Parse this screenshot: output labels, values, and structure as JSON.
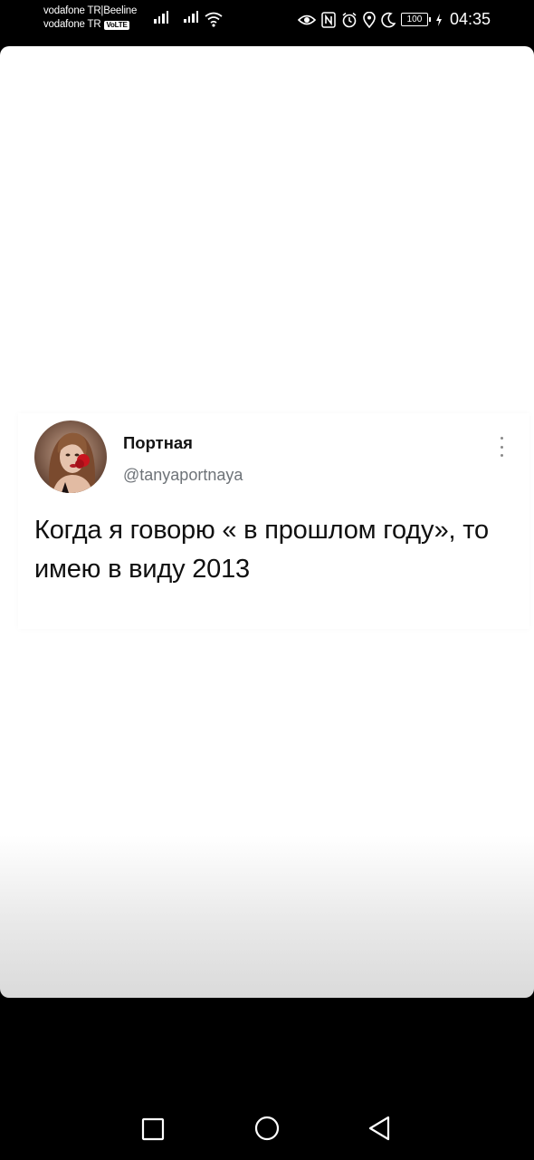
{
  "status_bar": {
    "carrier_1": "vodafone TR|Beeline",
    "carrier_2": "vodafone TR",
    "volte_badge": "VoLTE",
    "signal_1_label": "R",
    "battery": "100",
    "time": "04:35",
    "icons": [
      "eye-comfort-icon",
      "nfc-icon",
      "alarm-icon",
      "location-icon",
      "do-not-disturb-icon",
      "battery-icon",
      "charging-icon"
    ]
  },
  "tweet": {
    "display_name": "Портная",
    "handle": "@tanyaportnaya",
    "text": "Когда я говорю « в прошлом году», то имею в виду 2013"
  },
  "colors": {
    "background": "#000000",
    "card": "#ffffff",
    "handle_gray": "#6e7378"
  }
}
